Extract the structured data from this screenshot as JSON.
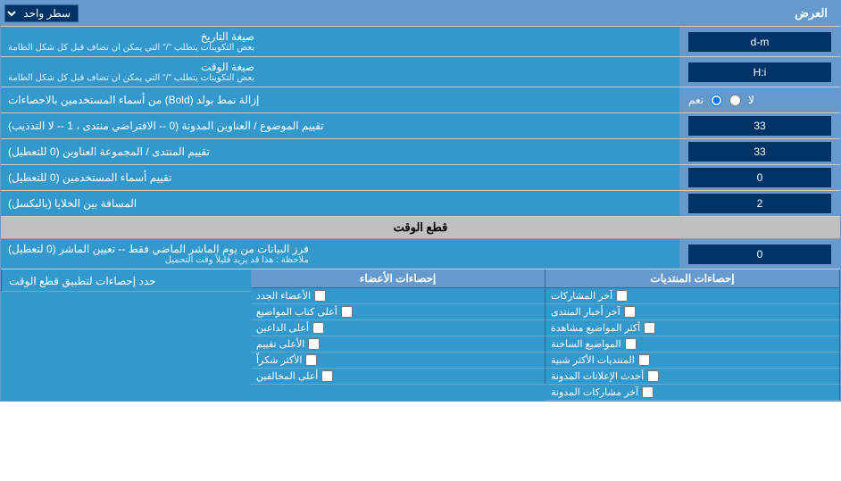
{
  "header": {
    "title": "العرض",
    "single_line_label": "سطر واحد"
  },
  "rows": [
    {
      "id": "date-format",
      "label": "صيغة التاريخ",
      "sublabel": "بعض التكوينات يتطلب \"/\" التي يمكن ان تضاف قبل كل شكل الطامة",
      "value": "d-m"
    },
    {
      "id": "time-format",
      "label": "صيغة الوقت",
      "sublabel": "بعض التكوينات يتطلب \"/\" التي يمكن ان تضاف قبل كل شكل الطامة",
      "value": "H:i"
    },
    {
      "id": "bold-remove",
      "label": "إزالة نمط بولد (Bold) من أسماء المستخدمين بالاحصاءات",
      "type": "radio",
      "options": [
        "نعم",
        "لا"
      ],
      "selected": "نعم"
    },
    {
      "id": "topics-order",
      "label": "تقييم الموضوع / العناوين المدونة (0 -- الافتراضي منتدى ، 1 -- لا التذذيب)",
      "value": "33"
    },
    {
      "id": "forum-order",
      "label": "تقييم المنتدى / المجموعة العناوين (0 للتعطيل)",
      "value": "33"
    },
    {
      "id": "users-order",
      "label": "تقييم أسماء المستخدمين (0 للتعطيل)",
      "value": "0"
    },
    {
      "id": "space-between",
      "label": "المسافة بين الخلايا (بالبكسل)",
      "value": "2"
    }
  ],
  "section_cut": {
    "title": "قطع الوقت"
  },
  "cut_row": {
    "label": "فرز البيانات من يوم الماشر الماضي فقط -- تعيين الماشر (0 لتعطيل)",
    "note": "ملاحظة : هذا قد يزيد قليلاً وقت التحميل",
    "value": "0"
  },
  "stats_label": "حدد إحصاءات لتطبيق قطع الوقت",
  "columns": [
    {
      "header": "إحصاءات المنتديات",
      "items": [
        "آخر المشاركات",
        "آخر أخبار المنتدى",
        "أكثر المواضيع مشاهدة",
        "المواضيع الساخنة",
        "المنتديات الأكثر شبية",
        "أحدث الإعلانات المدونة",
        "آخر مشاركات المدونة"
      ]
    },
    {
      "header": "إحصاءات الأعضاء",
      "items": [
        "الأعضاء الجدد",
        "أعلى كتاب المواضيع",
        "أعلى الداعين",
        "الأعلى تقييم",
        "الأكثر شكراً",
        "أعلى المخالفين"
      ]
    }
  ]
}
